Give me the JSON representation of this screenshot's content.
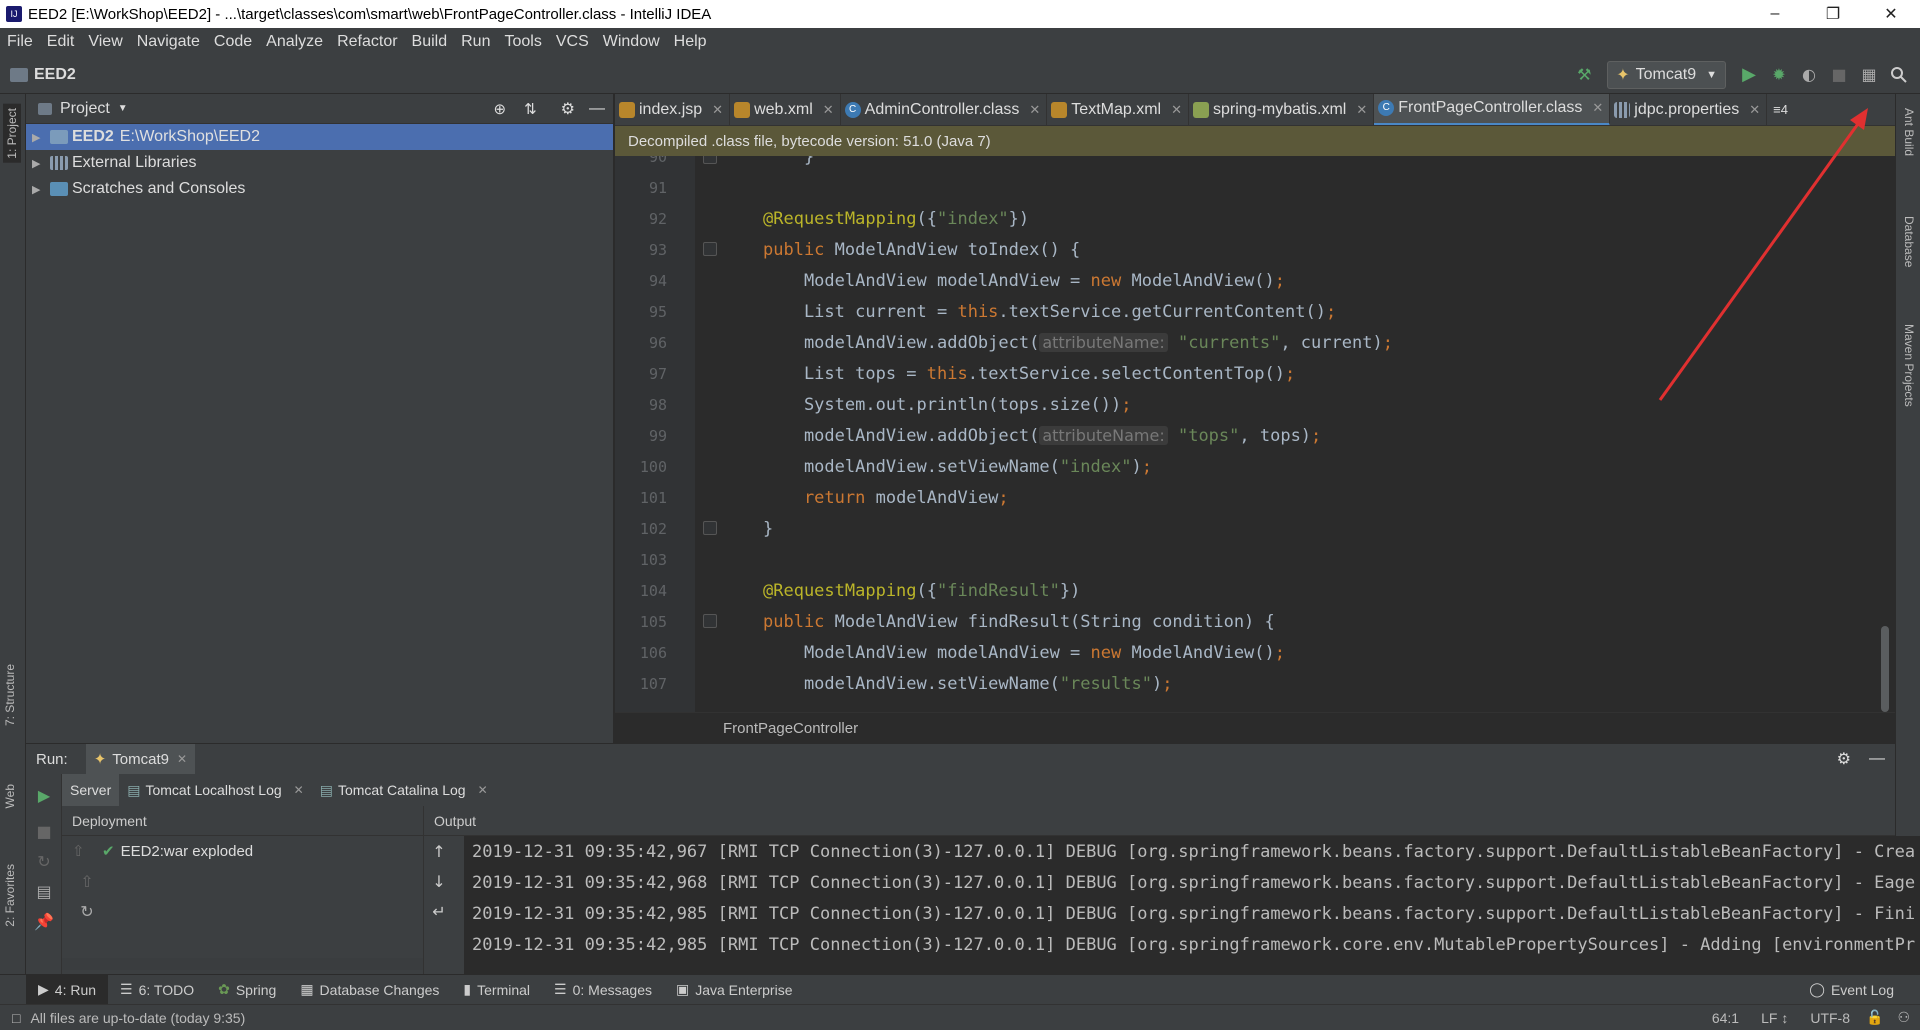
{
  "window": {
    "title": "EED2 [E:\\WorkShop\\EED2] - ...\\target\\classes\\com\\smart\\web\\FrontPageController.class - IntelliJ IDEA"
  },
  "menu": [
    "File",
    "Edit",
    "View",
    "Navigate",
    "Code",
    "Analyze",
    "Refactor",
    "Build",
    "Run",
    "Tools",
    "VCS",
    "Window",
    "Help"
  ],
  "nav": {
    "project_name": "EED2",
    "run_config": "Tomcat9"
  },
  "left_stripe": {
    "project": "1: Project",
    "structure": "7: Structure",
    "web": "Web",
    "favorites": "2: Favorites"
  },
  "right_stripe": {
    "ant": "Ant Build",
    "database": "Database",
    "maven": "Maven Projects"
  },
  "project_panel": {
    "title": "Project",
    "items": [
      {
        "name": "EED2",
        "path": "E:\\WorkShop\\EED2"
      },
      {
        "name": "External Libraries",
        "path": ""
      },
      {
        "name": "Scratches and Consoles",
        "path": ""
      }
    ]
  },
  "editor": {
    "tabs": [
      "index.jsp",
      "web.xml",
      "AdminController.class",
      "TextMap.xml",
      "spring-mybatis.xml",
      "FrontPageController.class",
      "jdpc.properties"
    ],
    "tab_overflow": "≡4",
    "banner": "Decompiled .class file, bytecode version: 51.0 (Java 7)",
    "line_numbers": [
      "90",
      "91",
      "92",
      "93",
      "94",
      "95",
      "96",
      "97",
      "98",
      "99",
      "100",
      "101",
      "102",
      "103",
      "104",
      "105",
      "106",
      "107"
    ],
    "lines": {
      "l90": "    }",
      "l92_ann": "@RequestMapping",
      "l92_a": "({",
      "l92_s": "\"index\"",
      "l92_b": "})",
      "l93_kw": "public",
      "l93": " ModelAndView toIndex() {",
      "l94_a": "    ModelAndView modelAndView = ",
      "l94_kw": "new",
      "l94_b": " ModelAndView()",
      "l94_c": ";",
      "l95_a": "    List current = ",
      "l95_kw": "this",
      "l95_b": ".textService.getCurrentContent()",
      "l95_c": ";",
      "l96_a": "    modelAndView.addObject(",
      "l96_hint": "attributeName:",
      "l96_s": " \"currents\"",
      "l96_b": ", current)",
      "l96_c": ";",
      "l97_a": "    List tops = ",
      "l97_kw": "this",
      "l97_b": ".textService.selectContentTop()",
      "l97_c": ";",
      "l98_a": "    System.out.println(tops.size())",
      "l98_c": ";",
      "l99_a": "    modelAndView.addObject(",
      "l99_hint": "attributeName:",
      "l99_s": " \"tops\"",
      "l99_b": ", tops)",
      "l99_c": ";",
      "l100_a": "    modelAndView.setViewName(",
      "l100_s": "\"index\"",
      "l100_b": ")",
      "l100_c": ";",
      "l101_kw": "    return",
      "l101_b": " modelAndView",
      "l101_c": ";",
      "l102": "}",
      "l104_ann": "@RequestMapping",
      "l104_a": "({",
      "l104_s": "\"findResult\"",
      "l104_b": "})",
      "l105_kw": "public",
      "l105": " ModelAndView findResult(String condition) {",
      "l106_a": "    ModelAndView modelAndView = ",
      "l106_kw": "new",
      "l106_b": " ModelAndView()",
      "l106_c": ";",
      "l107_a": "    modelAndView.setViewName(",
      "l107_s": "\"results\"",
      "l107_b": ")",
      "l107_c": ";"
    },
    "breadcrumb": "FrontPageController"
  },
  "run_panel": {
    "label": "Run:",
    "config": "Tomcat9",
    "tabs": [
      "Server",
      "Tomcat Localhost Log",
      "Tomcat Catalina Log"
    ],
    "deployment_header": "Deployment",
    "output_header": "Output",
    "deployment_item": "EED2:war exploded",
    "log": [
      "2019-12-31 09:35:42,967 [RMI TCP Connection(3)-127.0.0.1] DEBUG [org.springframework.beans.factory.support.DefaultListableBeanFactory] - Crea",
      "2019-12-31 09:35:42,968 [RMI TCP Connection(3)-127.0.0.1] DEBUG [org.springframework.beans.factory.support.DefaultListableBeanFactory] - Eage",
      "2019-12-31 09:35:42,985 [RMI TCP Connection(3)-127.0.0.1] DEBUG [org.springframework.beans.factory.support.DefaultListableBeanFactory] - Fini",
      "2019-12-31 09:35:42,985 [RMI TCP Connection(3)-127.0.0.1] DEBUG [org.springframework.core.env.MutablePropertySources] - Adding [environmentPr"
    ]
  },
  "tool_tabs": [
    "4: Run",
    "6: TODO",
    "Spring",
    "Database Changes",
    "Terminal",
    "0: Messages",
    "Java Enterprise"
  ],
  "event_log": "Event Log",
  "status": {
    "message": "All files are up-to-date (today 9:35)",
    "position": "64:1",
    "line_sep": "LF ↕",
    "encoding": "UTF-8"
  }
}
